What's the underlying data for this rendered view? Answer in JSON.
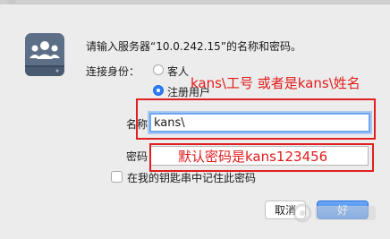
{
  "dialog": {
    "prompt": "请输入服务器“10.0.242.15”的名称和密码。",
    "connect_as_label": "连接身份：",
    "radio_guest": "客人",
    "radio_registered": "注册用户",
    "name_label": "名称：",
    "name_value": "kans\\",
    "password_label": "密码：",
    "password_value": "",
    "remember_label": "在我的钥匙串中记住此密码",
    "cancel_label": "取消",
    "ok_label": "好"
  },
  "annotations": {
    "name_hint": "kans\\工号 或者是kans\\姓名",
    "password_hint": "默认密码是kans123456"
  },
  "colors": {
    "annotation_red": "#e02020",
    "accent_blue": "#2d7ef7"
  }
}
